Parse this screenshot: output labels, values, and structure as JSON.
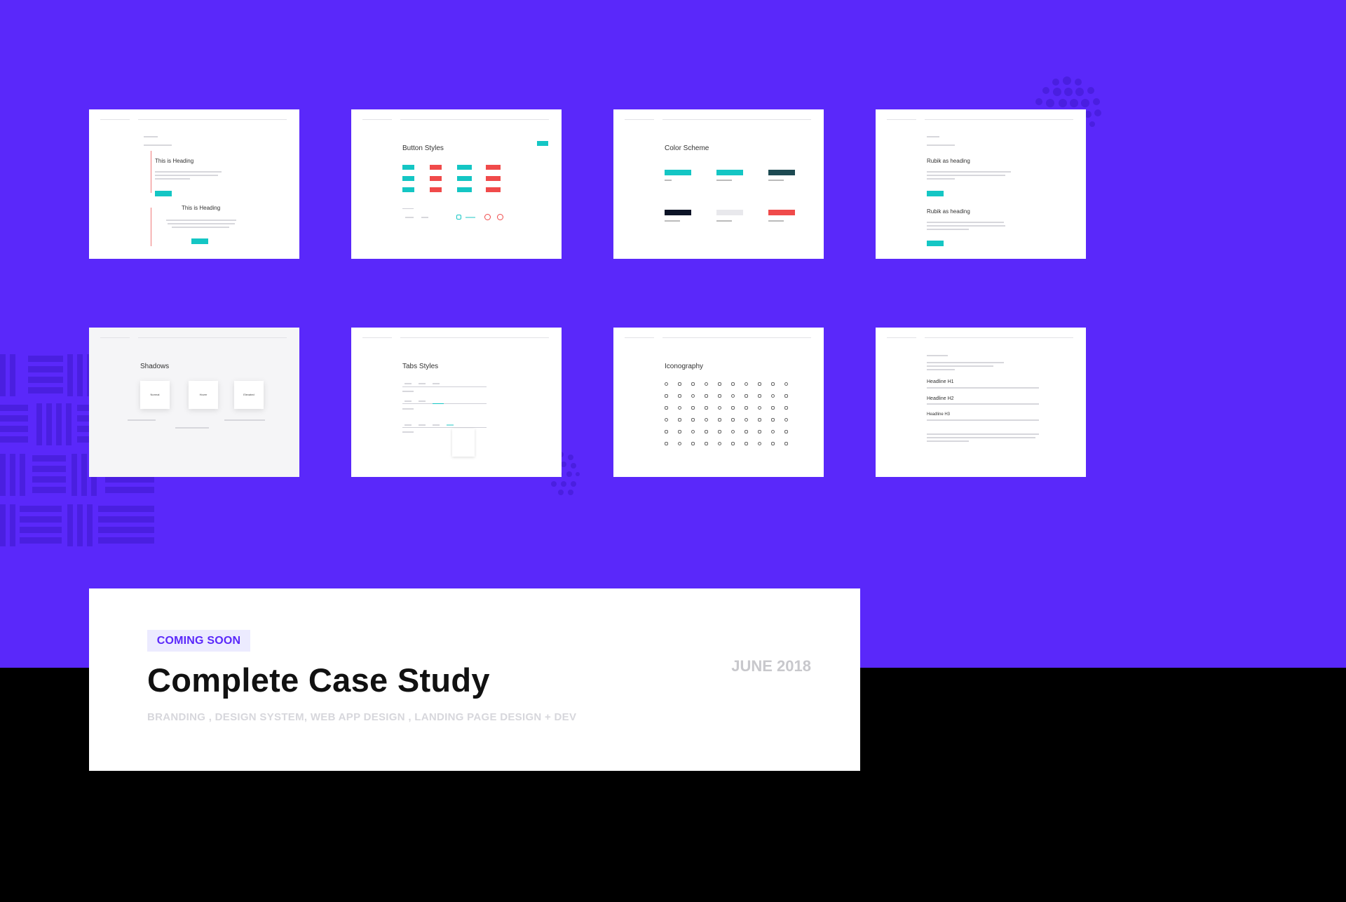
{
  "footer": {
    "badge": "COMING SOON",
    "title": "Complete Case Study",
    "date": "JUNE 2018",
    "subtitle": "BRANDING , DESIGN SYSTEM, WEB APP DESIGN , LANDING PAGE DESIGN + DEV"
  },
  "cards": {
    "blocks": {
      "title": "This is Heading",
      "title2": "This is Heading"
    },
    "buttons": {
      "title": "Button Styles"
    },
    "colors": {
      "title": "Color Scheme"
    },
    "rubik": {
      "title": "Rubik as heading",
      "title2": "Rubik as heading"
    },
    "shadows": {
      "title": "Shadows",
      "box1": "Normal",
      "box2": "Hover",
      "box3": "Elevated"
    },
    "tabs": {
      "title": "Tabs Styles"
    },
    "icons": {
      "title": "Iconography"
    },
    "typography": {
      "h1": "Headline H1",
      "h2": "Headline H2",
      "h3": "Headline H3"
    }
  },
  "colors": {
    "background": "#5a28fa",
    "teal": "#14c6c4",
    "red": "#f04a4a",
    "dark": "#0c1326"
  }
}
